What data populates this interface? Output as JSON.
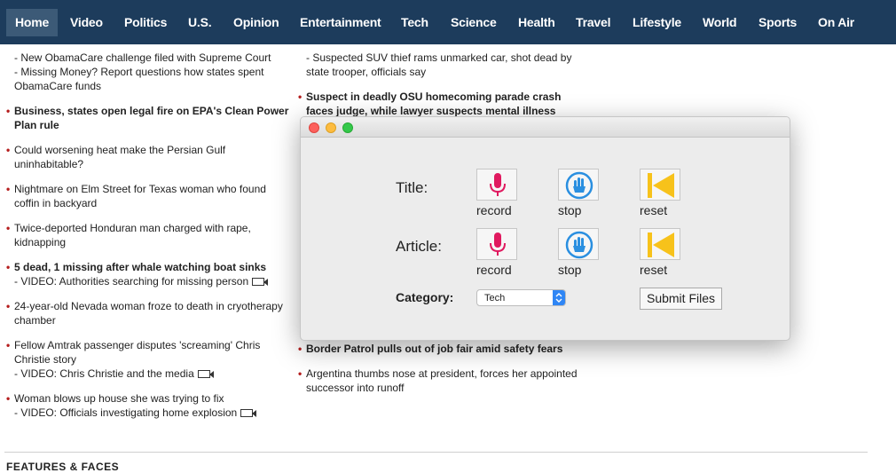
{
  "nav": {
    "items": [
      "Home",
      "Video",
      "Politics",
      "U.S.",
      "Opinion",
      "Entertainment",
      "Tech",
      "Science",
      "Health",
      "Travel",
      "Lifestyle",
      "World",
      "Sports",
      "On Air"
    ],
    "active": "Home"
  },
  "left_column": {
    "top_subs": [
      "- New ObamaCare challenge filed with Supreme Court",
      "- Missing Money? Report questions how states spent",
      "ObamaCare funds"
    ],
    "stories": [
      {
        "headline": "Business, states open legal fire on EPA's Clean Power Plan rule",
        "bold": true,
        "subs": []
      },
      {
        "headline": "Could worsening heat make the Persian Gulf uninhabitable?",
        "bold": false,
        "subs": []
      },
      {
        "headline": "Nightmare on Elm Street for Texas woman who found coffin in backyard",
        "bold": false,
        "subs": []
      },
      {
        "headline": "Twice-deported Honduran man charged with rape, kidnapping",
        "bold": false,
        "subs": []
      },
      {
        "headline": "5 dead, 1 missing after whale watching boat sinks",
        "bold": true,
        "subs": [
          "- VIDEO: Authorities searching for missing person"
        ]
      },
      {
        "headline": "24-year-old Nevada woman froze to death in cryotherapy chamber",
        "bold": false,
        "subs": []
      },
      {
        "headline": "Fellow Amtrak passenger disputes 'screaming' Chris Christie story",
        "bold": false,
        "subs": [
          "- VIDEO: Chris Christie and the media"
        ]
      },
      {
        "headline": "Woman blows up house she was trying to fix",
        "bold": false,
        "subs": [
          "- VIDEO: Officials investigating home explosion"
        ]
      }
    ]
  },
  "right_column": {
    "top_subs": [
      "- Suspected SUV thief rams unmarked car, shot dead by",
      "state trooper, officials say"
    ],
    "story1": "Suspect in deadly OSU homecoming parade crash faces judge, while lawyer suspects mental illness",
    "story2": "Border Patrol pulls out of job fair amid safety fears",
    "story3": "Argentina thumbs nose at president, forces her appointed successor into runoff"
  },
  "section_header": "FEATURES & FACES",
  "dialog": {
    "title_label": "Title:",
    "article_label": "Article:",
    "category_label": "Category:",
    "record_label": "record",
    "stop_label": "stop",
    "reset_label": "reset",
    "category_value": "Tech",
    "submit_label": "Submit Files",
    "colors": {
      "record": "#e0195f",
      "stop": "#2a8fe0",
      "reset": "#f7c21b"
    }
  }
}
